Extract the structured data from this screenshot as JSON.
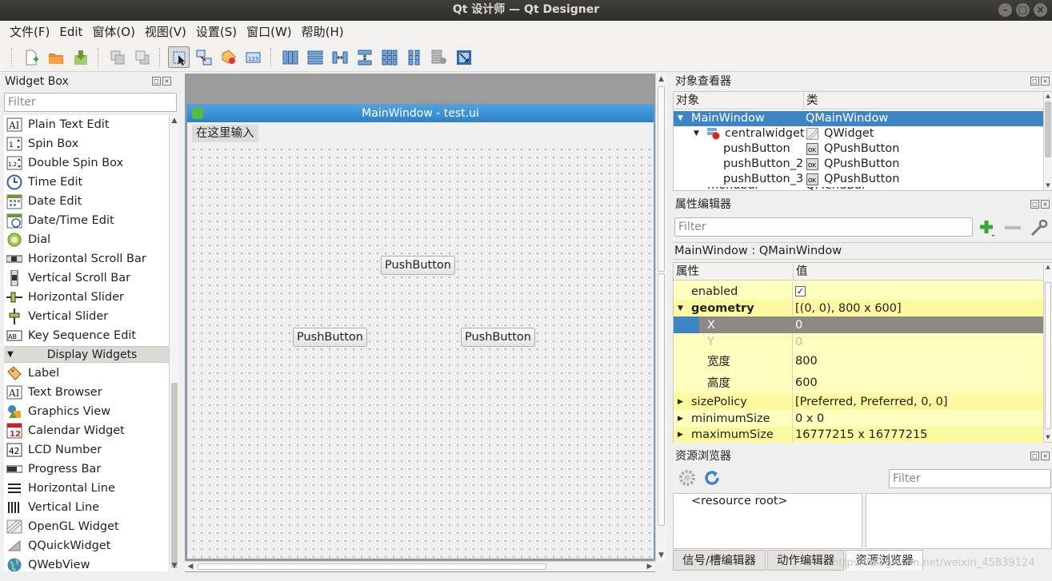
{
  "window": {
    "title": "Qt 设计师 — Qt Designer",
    "controls": [
      "–",
      "□",
      "×"
    ]
  },
  "menu": [
    "文件(F)",
    "Edit",
    "窗体(O)",
    "视图(V)",
    "设置(S)",
    "窗口(W)",
    "帮助(H)"
  ],
  "toolbar": {
    "icons": [
      "new-file-icon",
      "open-file-icon",
      "save-file-icon",
      "send-back-icon",
      "bring-front-icon",
      "edit-widgets-icon",
      "edit-signals-icon",
      "edit-buddies-icon",
      "edit-tab-order-icon",
      "layout-horizontal-icon",
      "layout-vertical-icon",
      "layout-horizontal-splitter-icon",
      "layout-vertical-splitter-icon",
      "layout-grid-icon",
      "layout-form-icon",
      "break-layout-icon",
      "adjust-size-icon"
    ]
  },
  "widget_box": {
    "title": "Widget Box",
    "filter_placeholder": "Filter",
    "items_top": [
      {
        "label": "Plain Text Edit",
        "icon": "plain-text-edit-icon"
      },
      {
        "label": "Spin Box",
        "icon": "spin-box-icon"
      },
      {
        "label": "Double Spin Box",
        "icon": "double-spin-box-icon"
      },
      {
        "label": "Time Edit",
        "icon": "time-edit-icon"
      },
      {
        "label": "Date Edit",
        "icon": "date-edit-icon"
      },
      {
        "label": "Date/Time Edit",
        "icon": "datetime-edit-icon"
      },
      {
        "label": "Dial",
        "icon": "dial-icon"
      },
      {
        "label": "Horizontal Scroll Bar",
        "icon": "horizontal-scrollbar-icon"
      },
      {
        "label": "Vertical Scroll Bar",
        "icon": "vertical-scrollbar-icon"
      },
      {
        "label": "Horizontal Slider",
        "icon": "horizontal-slider-icon"
      },
      {
        "label": "Vertical Slider",
        "icon": "vertical-slider-icon"
      },
      {
        "label": "Key Sequence Edit",
        "icon": "key-sequence-edit-icon"
      }
    ],
    "category": "Display Widgets",
    "items_display": [
      {
        "label": "Label",
        "icon": "label-icon"
      },
      {
        "label": "Text Browser",
        "icon": "text-browser-icon"
      },
      {
        "label": "Graphics View",
        "icon": "graphics-view-icon"
      },
      {
        "label": "Calendar Widget",
        "icon": "calendar-widget-icon"
      },
      {
        "label": "LCD Number",
        "icon": "lcd-number-icon"
      },
      {
        "label": "Progress Bar",
        "icon": "progress-bar-icon"
      },
      {
        "label": "Horizontal Line",
        "icon": "horizontal-line-icon"
      },
      {
        "label": "Vertical Line",
        "icon": "vertical-line-icon"
      },
      {
        "label": "OpenGL Widget",
        "icon": "opengl-widget-icon"
      },
      {
        "label": "QQuickWidget",
        "icon": "qquickwidget-icon"
      },
      {
        "label": "QWebView",
        "icon": "qwebview-icon"
      }
    ]
  },
  "form": {
    "title": "MainWindow - test.ui",
    "menu_placeholder": "在这里输入",
    "buttons": [
      "PushButton",
      "PushButton",
      "PushButton"
    ]
  },
  "object_inspector": {
    "title": "对象查看器",
    "col_object": "对象",
    "col_class": "类",
    "rows": [
      {
        "name": "MainWindow",
        "cls": "QMainWindow"
      },
      {
        "name": "centralwidget",
        "cls": "QWidget"
      },
      {
        "name": "pushButton",
        "cls": "QPushButton"
      },
      {
        "name": "pushButton_2",
        "cls": "QPushButton"
      },
      {
        "name": "pushButton_3",
        "cls": "QPushButton"
      },
      {
        "name": "menubar",
        "cls": "QMenuBar"
      }
    ]
  },
  "property_editor": {
    "title": "属性编辑器",
    "filter_placeholder": "Filter",
    "object_label": "MainWindow : QMainWindow",
    "col_property": "属性",
    "col_value": "值",
    "rows": [
      {
        "name": "enabled",
        "value": "✓"
      },
      {
        "name": "geometry",
        "value": "[(0, 0), 800 x 600]"
      },
      {
        "name": "X",
        "value": "0"
      },
      {
        "name": "Y",
        "value": "0"
      },
      {
        "name": "宽度",
        "value": "800"
      },
      {
        "name": "高度",
        "value": "600"
      },
      {
        "name": "sizePolicy",
        "value": "[Preferred, Preferred, 0, 0]"
      },
      {
        "name": "minimumSize",
        "value": "0 x 0"
      },
      {
        "name": "maximumSize",
        "value": "16777215 x 16777215"
      }
    ]
  },
  "resource_browser": {
    "title": "资源浏览器",
    "filter_placeholder": "Filter",
    "root": "<resource root>"
  },
  "bottom_tabs": [
    "信号/槽编辑器",
    "动作编辑器",
    "资源浏览器"
  ],
  "watermark": "https://blog.csdn.net/weixin_45839124"
}
